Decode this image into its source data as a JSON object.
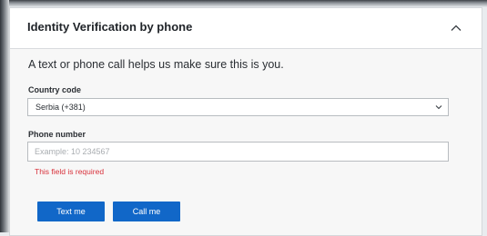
{
  "card": {
    "title": "Identity Verification by phone",
    "toggle_icon": "chevron-up-icon"
  },
  "intro": "A text or phone call helps us make sure this is you.",
  "country": {
    "label": "Country code",
    "value": "Serbia (+381)",
    "arrow_icon": "chevron-down-icon"
  },
  "phone": {
    "label": "Phone number",
    "placeholder": "Example: 10 234567",
    "value": "",
    "error": "This field is required"
  },
  "buttons": {
    "text_me": "Text me",
    "call_me": "Call me"
  },
  "colors": {
    "primary": "#1167c8",
    "error": "#d8313b"
  }
}
